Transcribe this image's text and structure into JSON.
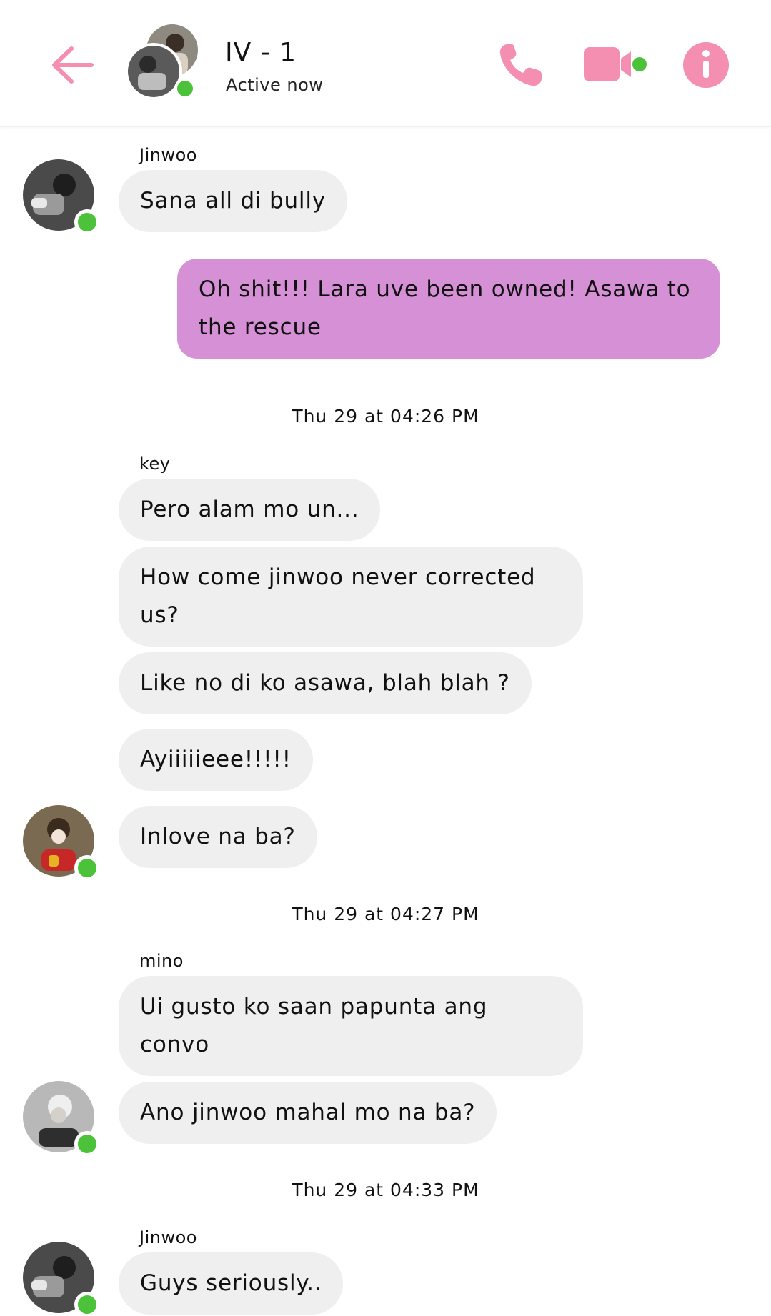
{
  "header": {
    "title": "IV - 1",
    "status": "Active now",
    "icons": {
      "back": "back-arrow-icon",
      "phone": "phone-icon",
      "video": "video-camera-icon",
      "info": "info-icon"
    }
  },
  "colors": {
    "accent": "#f48fb1",
    "online": "#4cc23a",
    "incoming_bubble": "#efefef",
    "outgoing_bubble": "#d690d6"
  },
  "messages": {
    "group1": {
      "sender": "Jinwoo",
      "bubbles": [
        "Sana all di bully"
      ]
    },
    "outgoing1": {
      "bubbles": [
        "Oh shit!!! Lara uve been owned! Asawa to the rescue"
      ]
    },
    "timestamp1": "Thu 29 at 04:26 PM",
    "group2": {
      "sender": "key",
      "bubbles": [
        "Pero alam mo un...",
        "How come jinwoo never corrected us?",
        "Like no di ko asawa, blah blah ?",
        "Ayiiiiieee!!!!!",
        "Inlove na ba?"
      ]
    },
    "timestamp2": "Thu 29 at 04:27 PM",
    "group3": {
      "sender": "mino",
      "bubbles": [
        "Ui gusto ko saan papunta ang convo",
        "Ano jinwoo mahal mo na ba?"
      ]
    },
    "timestamp3": "Thu 29 at 04:33 PM",
    "group4": {
      "sender": "Jinwoo",
      "bubbles": [
        "Guys seriously.."
      ]
    }
  }
}
